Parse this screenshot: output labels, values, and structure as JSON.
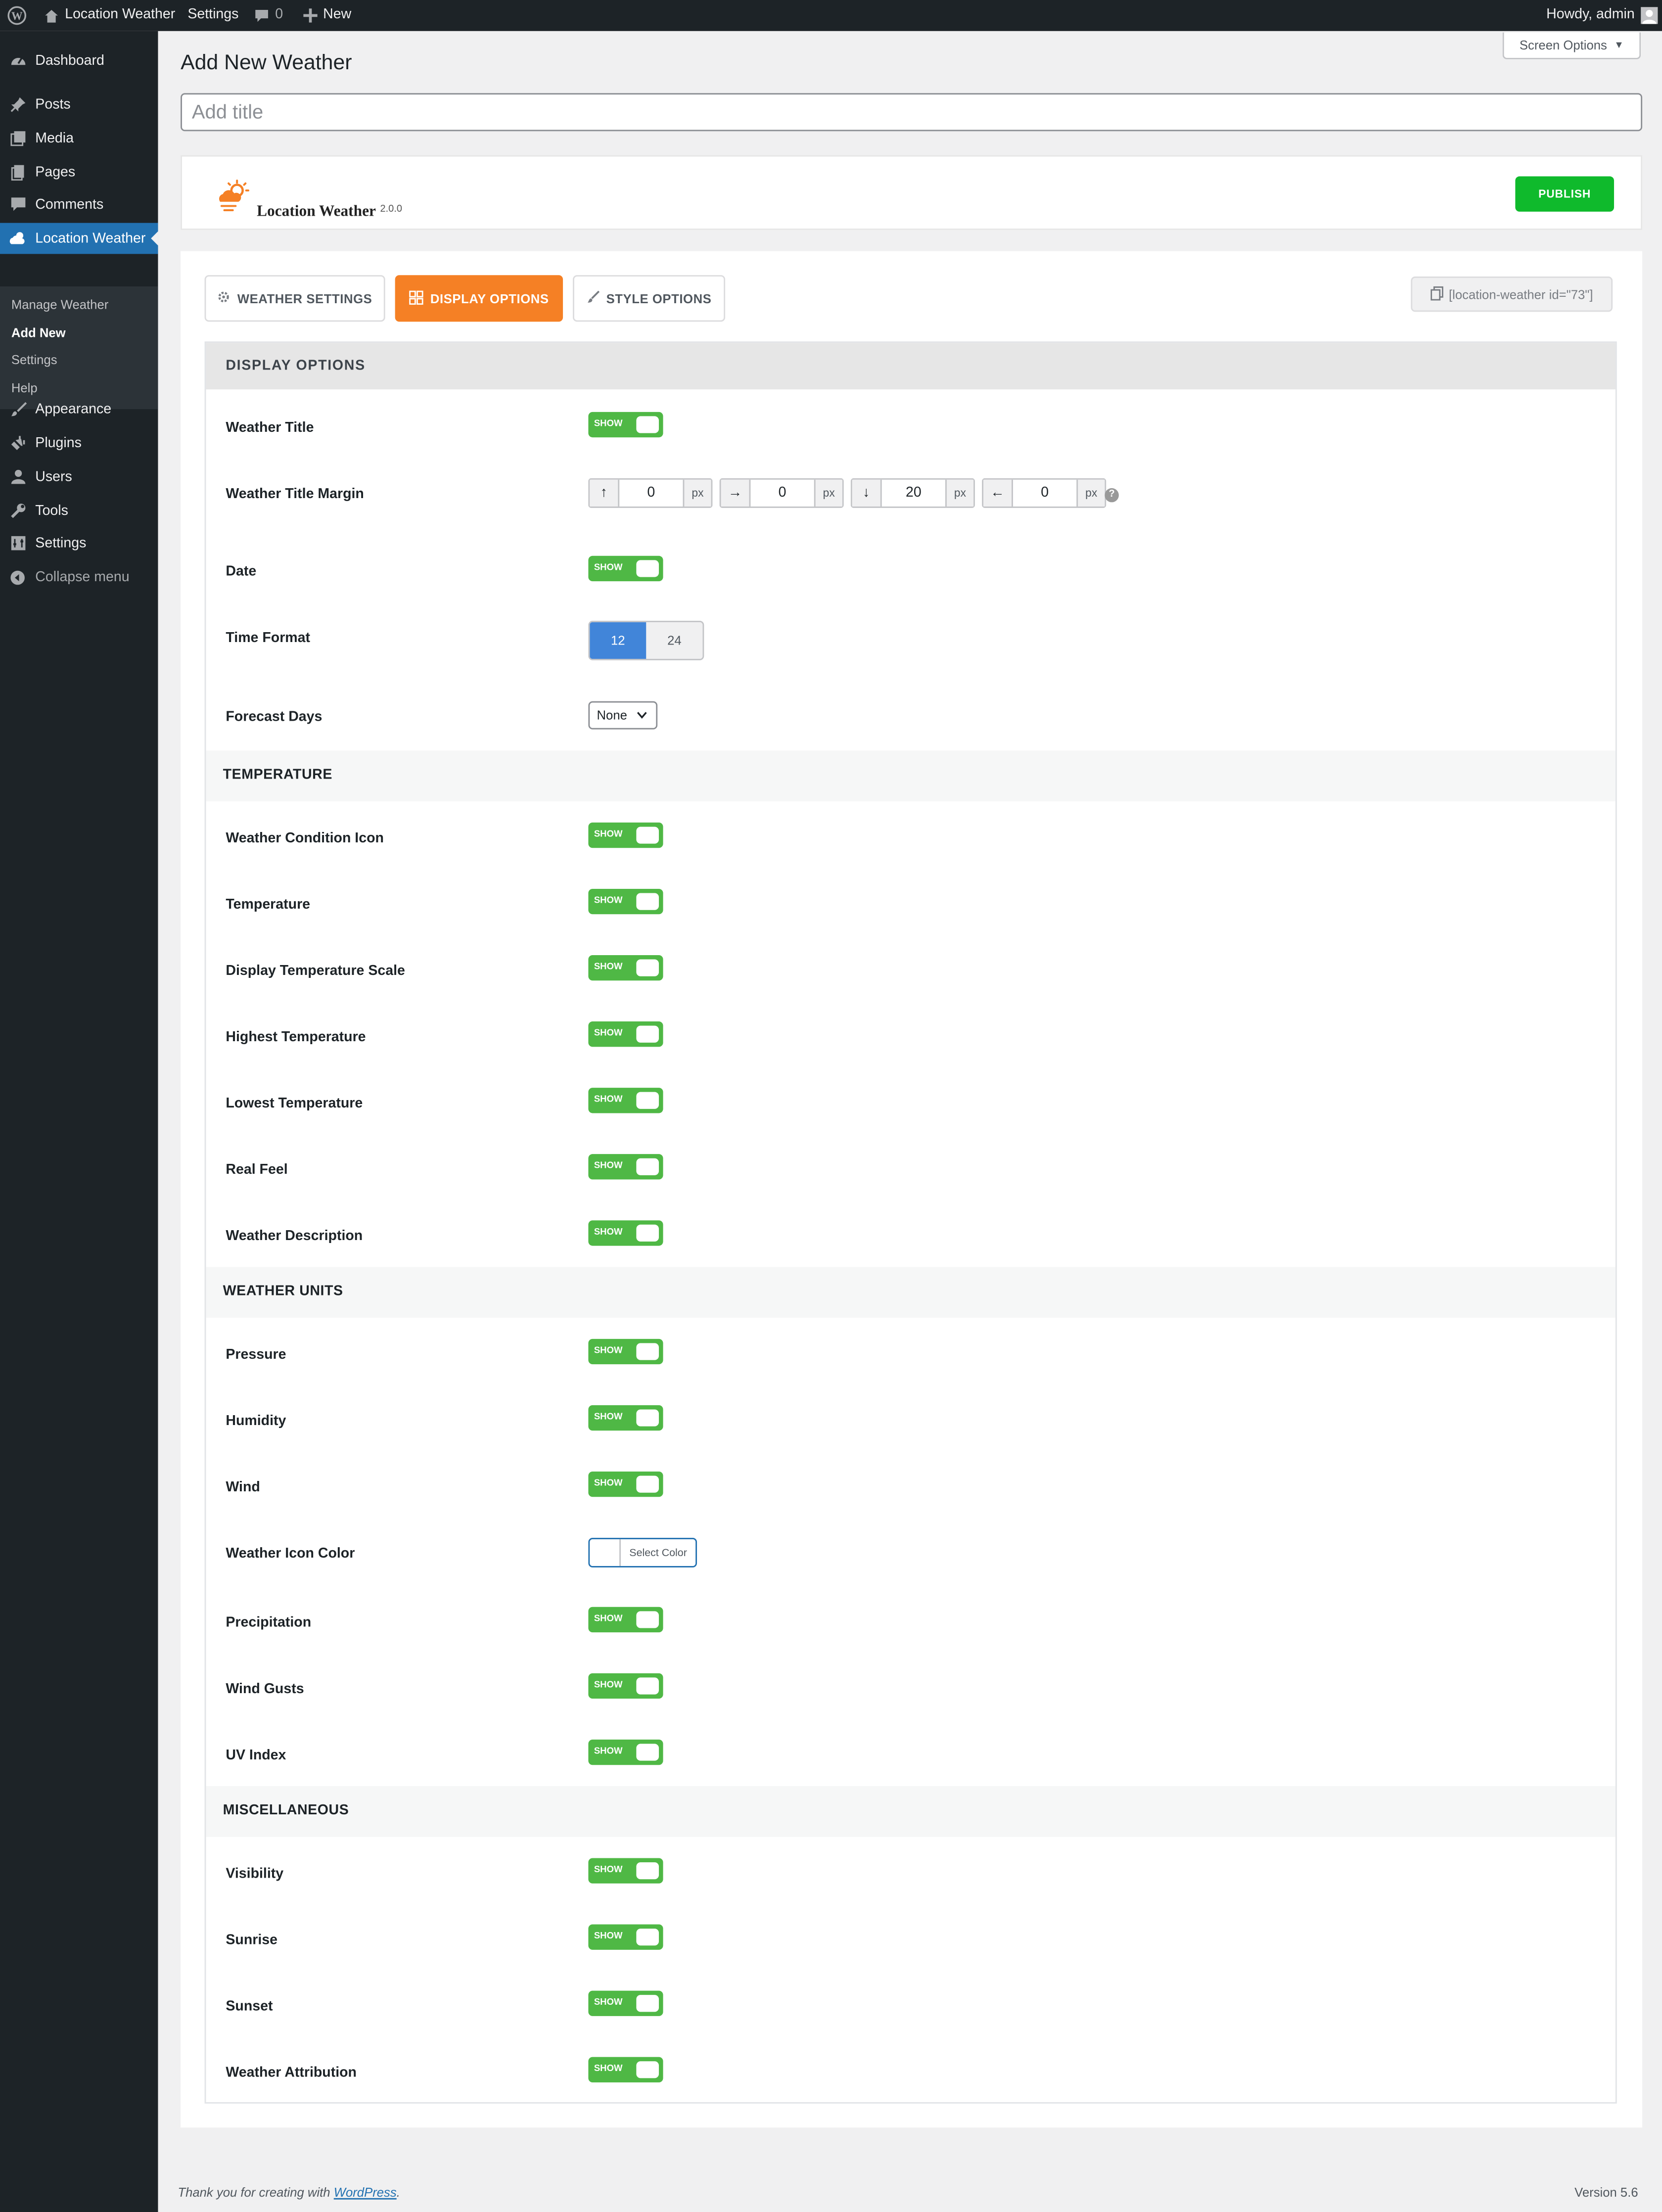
{
  "admin_bar": {
    "site_name": "Location Weather",
    "settings": "Settings",
    "comments_count": "0",
    "new": "New",
    "howdy": "Howdy, admin"
  },
  "sidebar": {
    "items": [
      {
        "label": "Dashboard",
        "icon": "dashboard-icon"
      },
      {
        "label": "Posts",
        "icon": "pin-icon"
      },
      {
        "label": "Media",
        "icon": "media-icon"
      },
      {
        "label": "Pages",
        "icon": "pages-icon"
      },
      {
        "label": "Comments",
        "icon": "comment-icon"
      },
      {
        "label": "Location Weather",
        "icon": "weather-icon",
        "active": true
      },
      {
        "label": "Appearance",
        "icon": "brush-icon"
      },
      {
        "label": "Plugins",
        "icon": "plugin-icon"
      },
      {
        "label": "Users",
        "icon": "user-icon"
      },
      {
        "label": "Tools",
        "icon": "wrench-icon"
      },
      {
        "label": "Settings",
        "icon": "settings-icon"
      },
      {
        "label": "Collapse menu",
        "icon": "collapse-icon"
      }
    ],
    "submenu": [
      "Manage Weather",
      "Add New",
      "Settings",
      "Help"
    ],
    "submenu_current": "Add New"
  },
  "page": {
    "title": "Add New Weather",
    "screen_options": "Screen Options",
    "title_placeholder": "Add title"
  },
  "header": {
    "brand": "Location Weather",
    "version": "2.0.0",
    "publish": "PUBLISH"
  },
  "tabs": [
    {
      "label": "WEATHER SETTINGS",
      "icon": "gear-icon"
    },
    {
      "label": "DISPLAY OPTIONS",
      "icon": "grid-icon",
      "active": true
    },
    {
      "label": "STYLE OPTIONS",
      "icon": "brush-icon"
    }
  ],
  "shortcode": "[location-weather id=\"73\"]",
  "panel_title": "DISPLAY OPTIONS",
  "switch_label": "SHOW",
  "fields": {
    "weather_title": "Weather Title",
    "weather_title_margin": "Weather Title Margin",
    "date": "Date",
    "time_format": "Time Format",
    "forecast_days": "Forecast Days"
  },
  "margin": {
    "top": "0",
    "right": "0",
    "bottom": "20",
    "left": "0",
    "unit": "px"
  },
  "time_format_options": [
    "12",
    "24"
  ],
  "time_format_selected": "12",
  "forecast_days_value": "None",
  "sections": {
    "temperature": {
      "title": "TEMPERATURE",
      "rows": [
        "Weather Condition Icon",
        "Temperature",
        "Display Temperature Scale",
        "Highest Temperature",
        "Lowest Temperature",
        "Real Feel",
        "Weather Description"
      ]
    },
    "weather_units": {
      "title": "WEATHER UNITS",
      "rows": [
        "Pressure",
        "Humidity",
        "Wind",
        "Weather Icon Color",
        "Precipitation",
        "Wind Gusts",
        "UV Index"
      ]
    },
    "misc": {
      "title": "MISCELLANEOUS",
      "rows": [
        "Visibility",
        "Sunrise",
        "Sunset",
        "Weather Attribution"
      ]
    }
  },
  "color_picker_label": "Select Color",
  "colors": {
    "admin_dark": "#1d2327",
    "active_blue": "#2271b1",
    "tab_orange": "#f58025",
    "switch_green": "#4fb845",
    "publish_green": "#0fba2c",
    "segment_blue": "#4185d9"
  },
  "footer": {
    "thanks_prefix": "Thank you for creating with ",
    "wordpress_link": "WordPress",
    "thanks_suffix": ".",
    "version": "Version 5.6"
  }
}
